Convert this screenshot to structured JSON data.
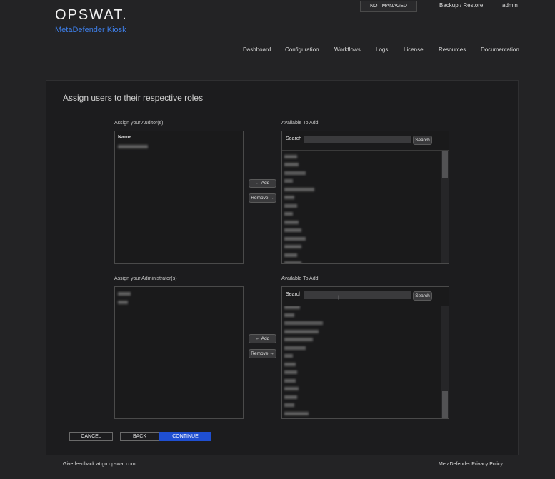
{
  "header": {
    "logo": "OPSWAT.",
    "product": "MetaDefender Kiosk",
    "status_badge": "NOT MANAGED",
    "backup_restore": "Backup / Restore",
    "user": "admin"
  },
  "nav": [
    "Dashboard",
    "Configuration",
    "Workflows",
    "Logs",
    "License",
    "Resources",
    "Documentation"
  ],
  "page": {
    "title": "Assign users to their respective roles"
  },
  "auditors": {
    "label": "Assign your Auditor(s)",
    "column_header": "Name",
    "available_label": "Available To Add",
    "search_label": "Search",
    "search_button": "Search",
    "search_value": ""
  },
  "administrators": {
    "label": "Assign your Administrator(s)",
    "available_label": "Available To Add",
    "search_label": "Search",
    "search_button": "Search",
    "search_value": ""
  },
  "transfer": {
    "add": "← Add",
    "remove": "Remove →"
  },
  "footer": {
    "cancel": "CANCEL",
    "back": "BACK",
    "continue": "CONTINUE",
    "feedback": "Give feedback at go.opswat.com",
    "privacy": "MetaDefender Privacy Policy"
  },
  "colors": {
    "accent": "#1f4fd1",
    "brand_blue": "#3d7de6",
    "background": "#232325"
  }
}
